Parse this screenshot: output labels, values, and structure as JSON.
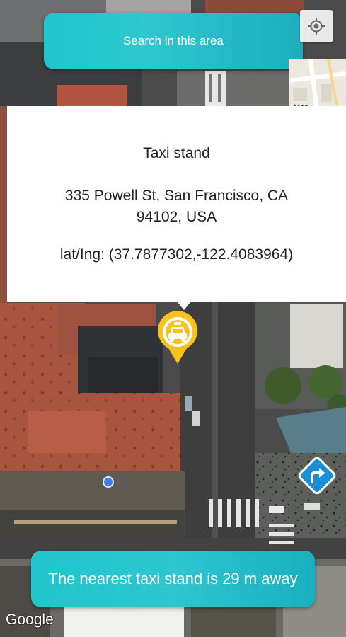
{
  "search": {
    "label": "Search in this area"
  },
  "map_toggle": {
    "label": "Map"
  },
  "info_card": {
    "title": "Taxi stand",
    "address_line1": "335 Powell St, San Francisco, CA",
    "address_line2": "94102, USA",
    "latlng": "lat/Ing: (37.7877302,-122.4083964)"
  },
  "banner": {
    "text": "The nearest taxi stand is 29 m away"
  },
  "attribution": {
    "google": "Google"
  },
  "icons": {
    "locate": "my-location-icon",
    "taxi": "taxi-marker-icon",
    "directions": "directions-turn-right-icon",
    "user": "user-location-dot"
  },
  "colors": {
    "accent": "#1fc6cc",
    "marker": "#f7c21d",
    "directions": "#1a8fd6",
    "user_dot": "#3d7ef2"
  }
}
